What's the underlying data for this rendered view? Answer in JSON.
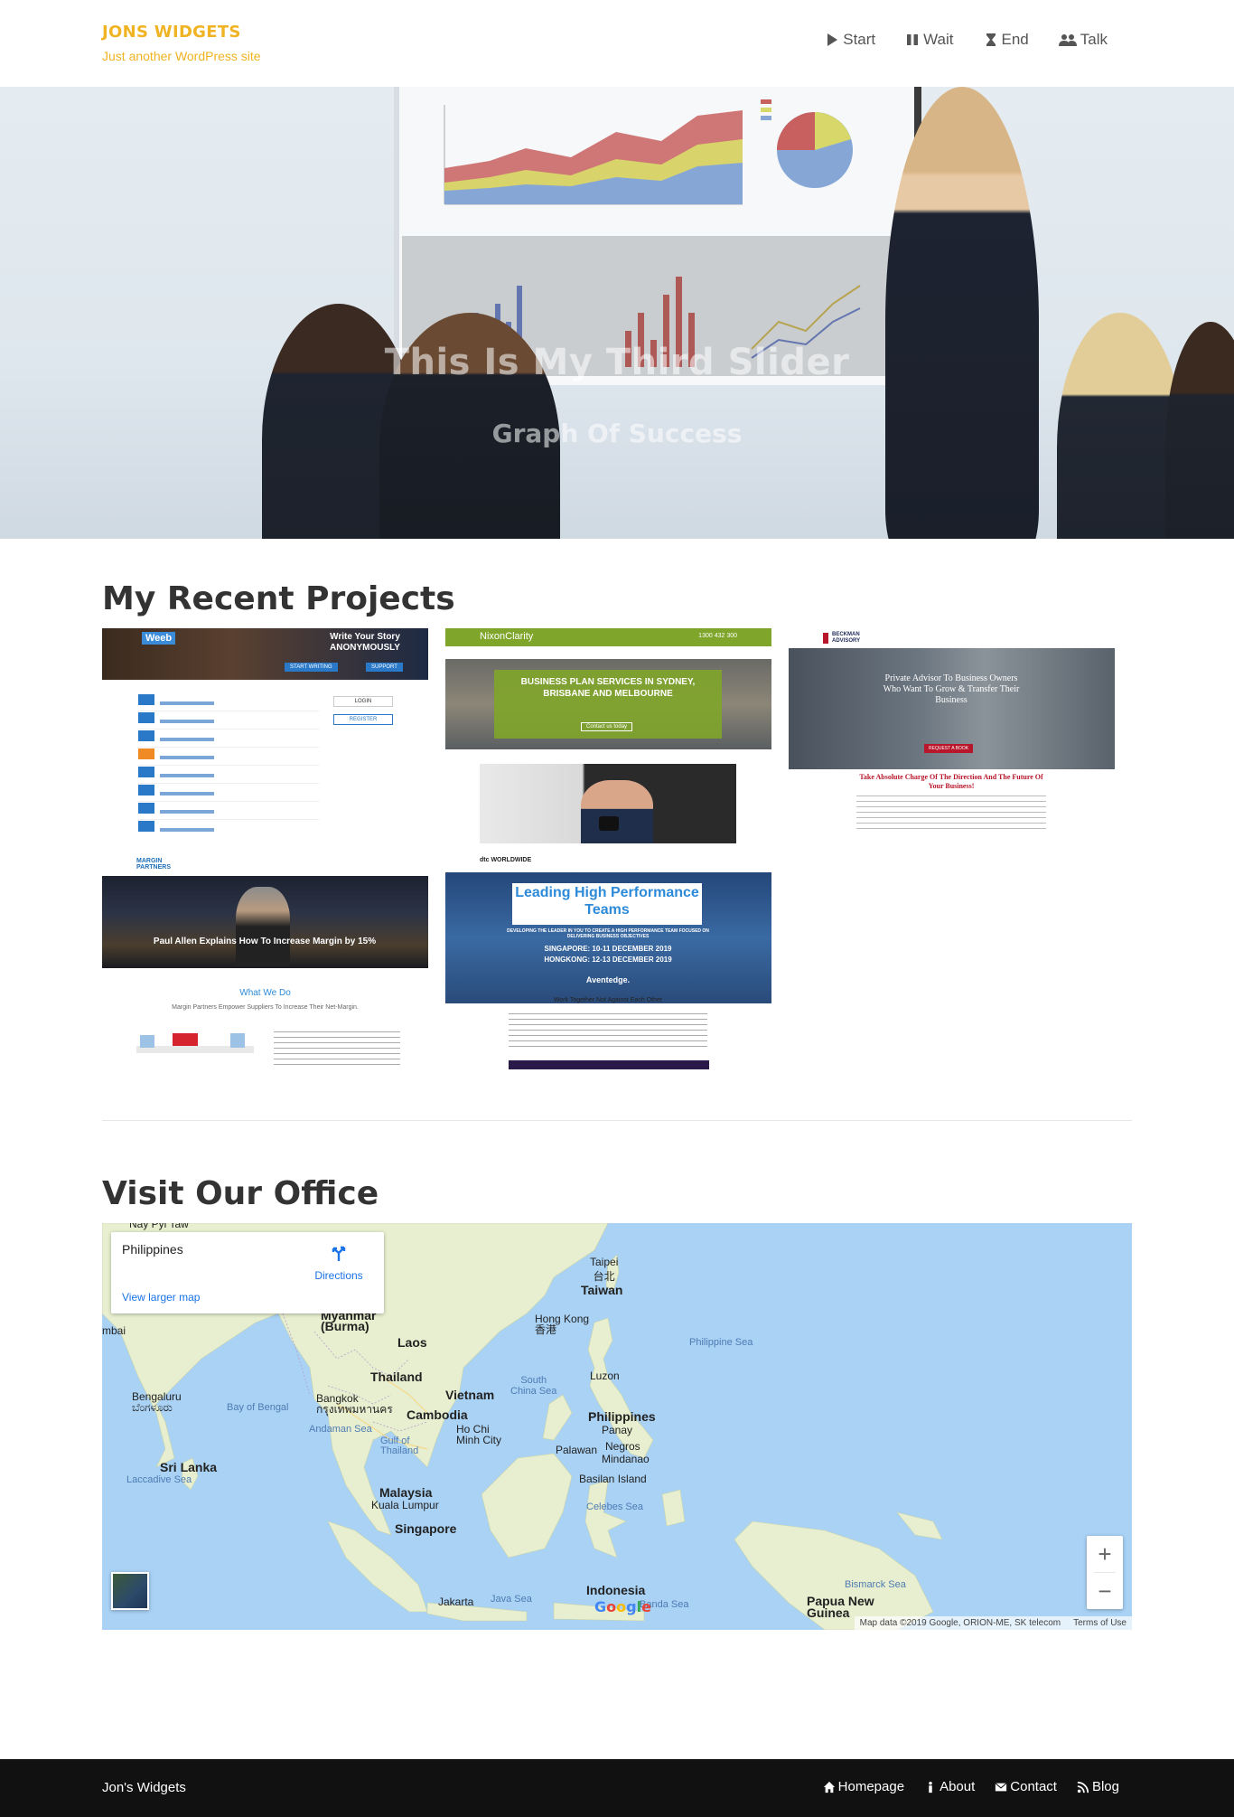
{
  "header": {
    "site_title": "JONS WIDGETS",
    "tagline": "Just another WordPress site",
    "nav": [
      {
        "label": "Start",
        "icon": "play-icon"
      },
      {
        "label": "Wait",
        "icon": "pause-icon"
      },
      {
        "label": "End",
        "icon": "hourglass-icon"
      },
      {
        "label": "Talk",
        "icon": "users-icon"
      }
    ]
  },
  "hero": {
    "title": "This Is My Third Slider",
    "subtitle": "Graph Of Success"
  },
  "projects": {
    "heading": "My Recent Projects",
    "items": [
      {
        "banner": "Write Your Story ANONYMOUSLY",
        "logo": "Weeb",
        "btn1": "START WRITING",
        "btn2": "SUPPORT",
        "login": "LOGIN",
        "register": "REGISTER"
      },
      {
        "brand": "NixonClarity",
        "phone": "1300 432 300",
        "headline": "BUSINESS PLAN SERVICES IN SYDNEY, BRISBANE AND MELBOURNE",
        "cta": "Contact us today"
      },
      {
        "brand": "BECKMAN ADVISORY",
        "headline": "Private Advisor To Business Owners Who Want To Grow & Transfer Their Business",
        "sub": "Take Absolute Charge Of The Direction And The Future Of Your Business!",
        "cta": "REQUEST A BOOK"
      },
      {
        "brand": "MARGIN PARTNERS",
        "headline": "Paul Allen Explains How To Increase Margin by 15%",
        "section": "What We Do",
        "section_sub": "Margin Partners Empower Suppliers To Increase Their Net-Margin."
      },
      {
        "brand": "dtc WORLDWIDE",
        "headline": "Leading High Performance Teams",
        "sub": "DEVELOPING THE LEADER IN YOU TO CREATE A HIGH PERFORMANCE TEAM FOCUSED ON DELIVERING BUSINESS OBJECTIVES",
        "dates1": "SINGAPORE: 10-11 DECEMBER 2019",
        "dates2": "HONGKONG: 12-13 DECEMBER 2019",
        "partner": "Aventedge.",
        "tagline": "Work Together Not Against Each Other"
      }
    ]
  },
  "office": {
    "heading": "Visit Our Office",
    "map": {
      "place": "Philippines",
      "directions": "Directions",
      "view_larger": "View larger map",
      "attribution": "Map data ©2019 Google, ORION-ME, SK telecom",
      "terms": "Terms of Use",
      "google": "Google",
      "labels": {
        "taipei": "Taipei\n台北",
        "taiwan": "Taiwan",
        "myanmar": "Myanmar\n(Burma)",
        "laos": "Laos",
        "hongkong": "Hong Kong\n香港",
        "philippine_sea": "Philippine Sea",
        "thailand": "Thailand",
        "vietnam": "Vietnam",
        "south_china_sea": "South\nChina Sea",
        "luzon": "Luzon",
        "bengaluru": "Bengaluru\nಬೆಂಗಳೂರು",
        "bay_of_bengal": "Bay of Bengal",
        "bangkok": "Bangkok\nกรุงเทพมหานคร",
        "cambodia": "Cambodia",
        "philippines": "Philippines",
        "panay": "Panay",
        "andaman_sea": "Andaman Sea",
        "hochiminh": "Ho Chi\nMinh City",
        "palawan": "Palawan",
        "negros": "Negros",
        "mindanao": "Mindanao",
        "gulf_thailand": "Gulf of\nThailand",
        "srilanka": "Sri Lanka",
        "laccadive": "Laccadive Sea",
        "basilan": "Basilan Island",
        "malaysia": "Malaysia",
        "kualalumpur": "Kuala Lumpur",
        "celebes": "Celebes Sea",
        "singapore": "Singapore",
        "bismarck": "Bismarck Sea",
        "indonesia": "Indonesia",
        "jakarta": "Jakarta",
        "java_sea": "Java Sea",
        "banda": "Banda Sea",
        "png": "Papua New\nGuinea",
        "mbai": "mbai",
        "mumbai_top": "Nay Pyi Taw"
      }
    }
  },
  "footer": {
    "brand": "Jon's Widgets",
    "links": [
      {
        "label": "Homepage",
        "icon": "home-icon"
      },
      {
        "label": "About",
        "icon": "info-icon"
      },
      {
        "label": "Contact",
        "icon": "envelope-icon"
      },
      {
        "label": "Blog",
        "icon": "rss-icon"
      }
    ]
  },
  "colors": {
    "brand": "#f0b323",
    "footer_bg": "#111111",
    "map_water": "#a9d2f5",
    "map_land": "#e8efd0",
    "link": "#1a73e8"
  }
}
